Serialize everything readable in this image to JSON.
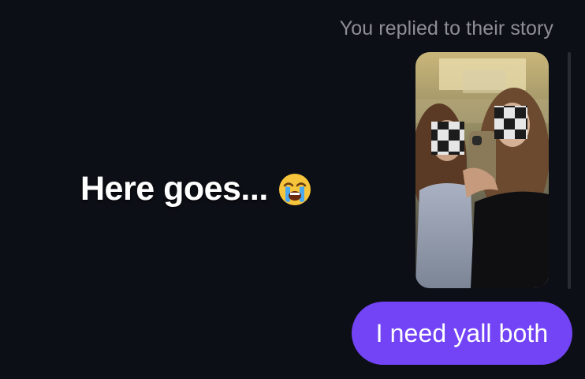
{
  "conversation": {
    "reply_note": "You replied to their story",
    "story": {
      "overlay_text": "Here goes...",
      "overlay_emoji": "loudly-crying-face-icon",
      "thumbnail": "story-photo"
    },
    "messages": [
      {
        "sender": "me",
        "text": "I need yall both"
      }
    ]
  },
  "colors": {
    "background": "#0d0f16",
    "bubble": "#7244f6",
    "muted_text": "#8e8f96"
  }
}
